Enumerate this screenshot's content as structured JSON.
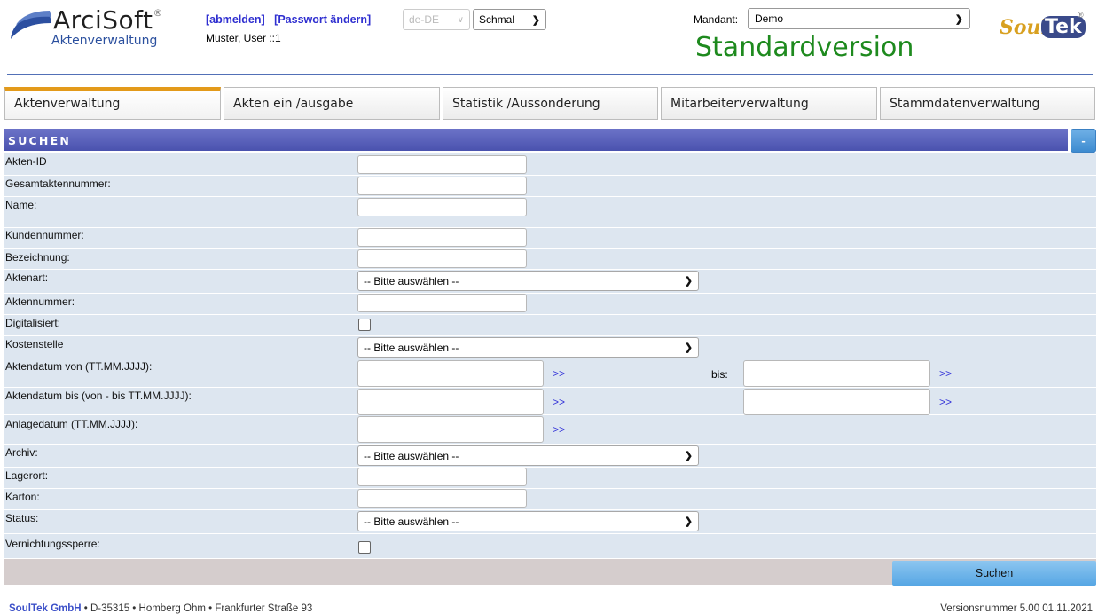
{
  "header": {
    "logo_brand": "ArciSoft",
    "logo_registered": "®",
    "logo_sub": "Aktenverwaltung",
    "logout_link": "[abmelden]",
    "password_link": "[Passwort ändern]",
    "user_line": "Muster, User ::1",
    "language_select": "de-DE",
    "width_select": "Schmal",
    "mandant_label": "Mandant:",
    "mandant_select": "Demo",
    "version_title": "Standardversion",
    "logo_right_soul": "Soul",
    "logo_right_tek": "Tek",
    "logo_right_reg": "®"
  },
  "tabs": [
    {
      "label": "Aktenverwaltung",
      "active": true
    },
    {
      "label": "Akten ein /ausgabe"
    },
    {
      "label": "Statistik /Aussonderung"
    },
    {
      "label": "Mitarbeiterverwaltung"
    },
    {
      "label": "Stammdatenverwaltung"
    }
  ],
  "panel": {
    "title": "SUCHEN",
    "collapse_label": "-"
  },
  "form": {
    "akten_id": "Akten-ID",
    "gesamtaktennummer": "Gesamtaktennummer:",
    "name": "Name:",
    "kundennummer": "Kundennummer:",
    "bezeichnung": "Bezeichnung:",
    "aktenart": "Aktenart:",
    "aktenart_value": "-- Bitte auswählen --",
    "aktennummer": "Aktennummer:",
    "digitalisiert": "Digitalisiert:",
    "kostenstelle": "Kostenstelle",
    "kostenstelle_value": "-- Bitte auswählen --",
    "aktendatum_von": "Aktendatum von (TT.MM.JJJJ):",
    "aktendatum_bis": "Aktendatum bis (von - bis TT.MM.JJJJ):",
    "anlagedatum": "Anlagedatum (TT.MM.JJJJ):",
    "bis_label": "bis:",
    "picker_arrow": ">>",
    "archiv": "Archiv:",
    "archiv_value": "-- Bitte auswählen --",
    "lagerort": "Lagerort:",
    "karton": "Karton:",
    "status": "Status:",
    "status_value": "-- Bitte auswählen --",
    "vernichtungssperre": "Vernichtungssperre:"
  },
  "actions": {
    "search_button": "Suchen"
  },
  "footer": {
    "company": "SoulTek GmbH",
    "address": " • D-35315 • Homberg Ohm • Frankfurter Straße 93",
    "version": "Versionsnummer 5.00 01.11.2021"
  },
  "colors": {
    "panel_header": "#5a61bb",
    "form_bg": "#dde6f0",
    "accent_green": "#1e8a1e",
    "active_tab_border": "#e39a1a",
    "link_blue": "#2f2fd0"
  }
}
